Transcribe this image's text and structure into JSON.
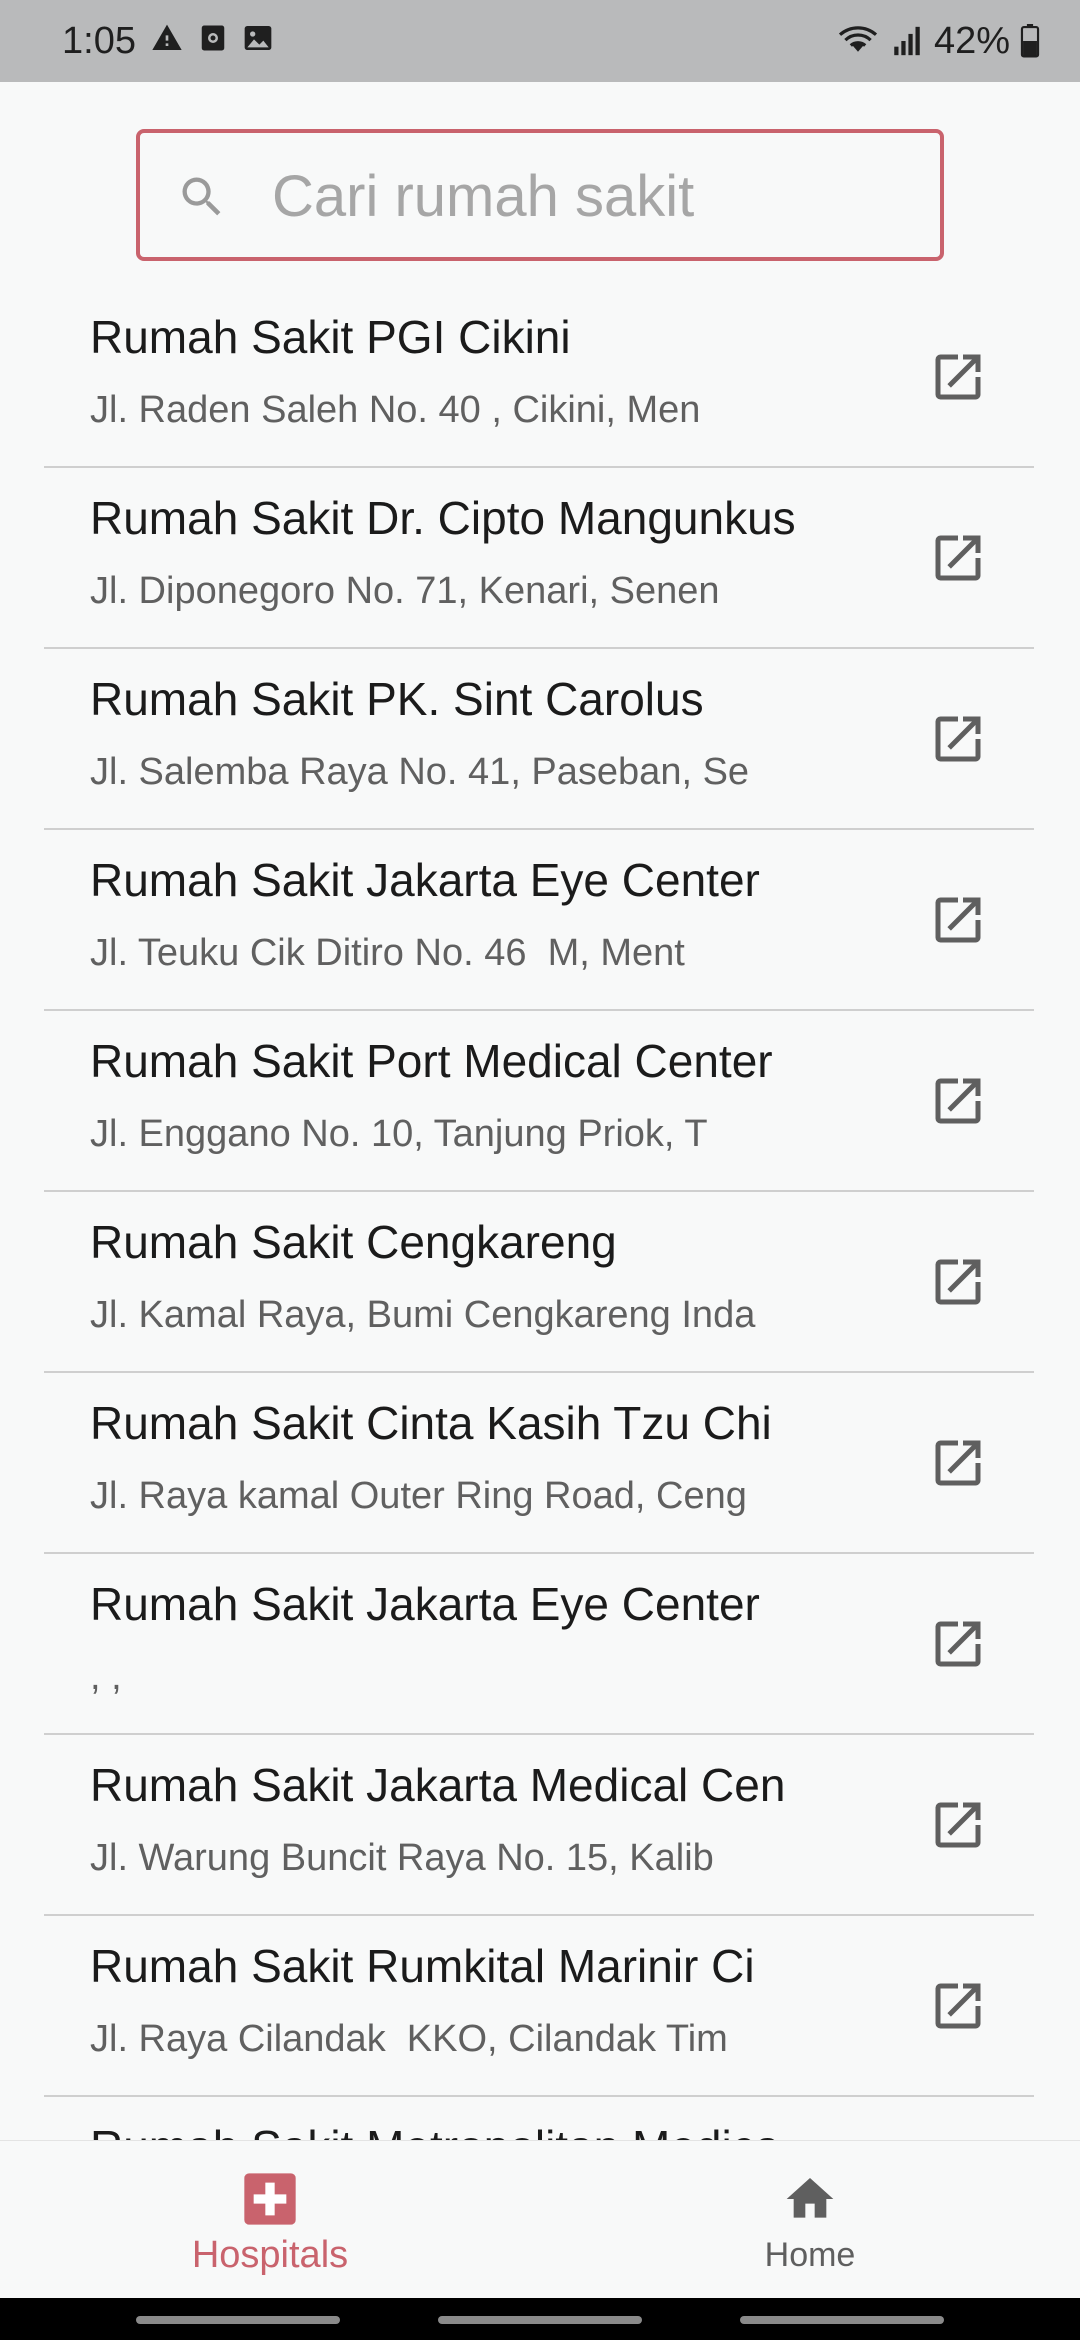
{
  "status_bar": {
    "time": "1:05",
    "battery": "42%",
    "icons_left": [
      "warning-icon",
      "sim-icon",
      "image-icon"
    ],
    "icons_right": [
      "wifi-icon",
      "signal-icon",
      "battery-icon"
    ]
  },
  "search": {
    "placeholder": "Cari rumah sakit",
    "value": ""
  },
  "hospitals": [
    {
      "name": "Rumah Sakit PGI Cikini",
      "address": "Jl. Raden Saleh No. 40 , Cikini, Men"
    },
    {
      "name": "Rumah Sakit Dr. Cipto Mangunkus",
      "address": "Jl. Diponegoro No. 71, Kenari, Senen"
    },
    {
      "name": "Rumah Sakit PK. Sint Carolus",
      "address": "Jl. Salemba Raya No. 41, Paseban, Se"
    },
    {
      "name": "Rumah Sakit Jakarta Eye Center",
      "address": "Jl. Teuku Cik Ditiro No. 46  M, Ment"
    },
    {
      "name": "Rumah Sakit Port Medical Center",
      "address": "Jl. Enggano No. 10, Tanjung Priok, T"
    },
    {
      "name": "Rumah Sakit Cengkareng",
      "address": "Jl. Kamal Raya, Bumi Cengkareng Inda"
    },
    {
      "name": "Rumah Sakit Cinta Kasih Tzu Chi",
      "address": "Jl. Raya kamal Outer Ring Road, Ceng"
    },
    {
      "name": "Rumah Sakit Jakarta Eye Center",
      "address": ", ,"
    },
    {
      "name": "Rumah Sakit Jakarta Medical Cen",
      "address": "Jl. Warung Buncit Raya No. 15, Kalib"
    },
    {
      "name": "Rumah Sakit Rumkital Marinir Ci",
      "address": "Jl. Raya Cilandak  KKO, Cilandak Tim"
    },
    {
      "name": "Rumah Sakit Metropolitan Medica",
      "address": ""
    }
  ],
  "bottom_nav": {
    "hospitals_label": "Hospitals",
    "home_label": "Home",
    "active": "hospitals"
  },
  "colors": {
    "accent": "#c9636d",
    "status_bar": "#b9babb",
    "background": "#f8f9f9",
    "divider": "#cfcfcf",
    "icon": "#5f5f5f"
  }
}
